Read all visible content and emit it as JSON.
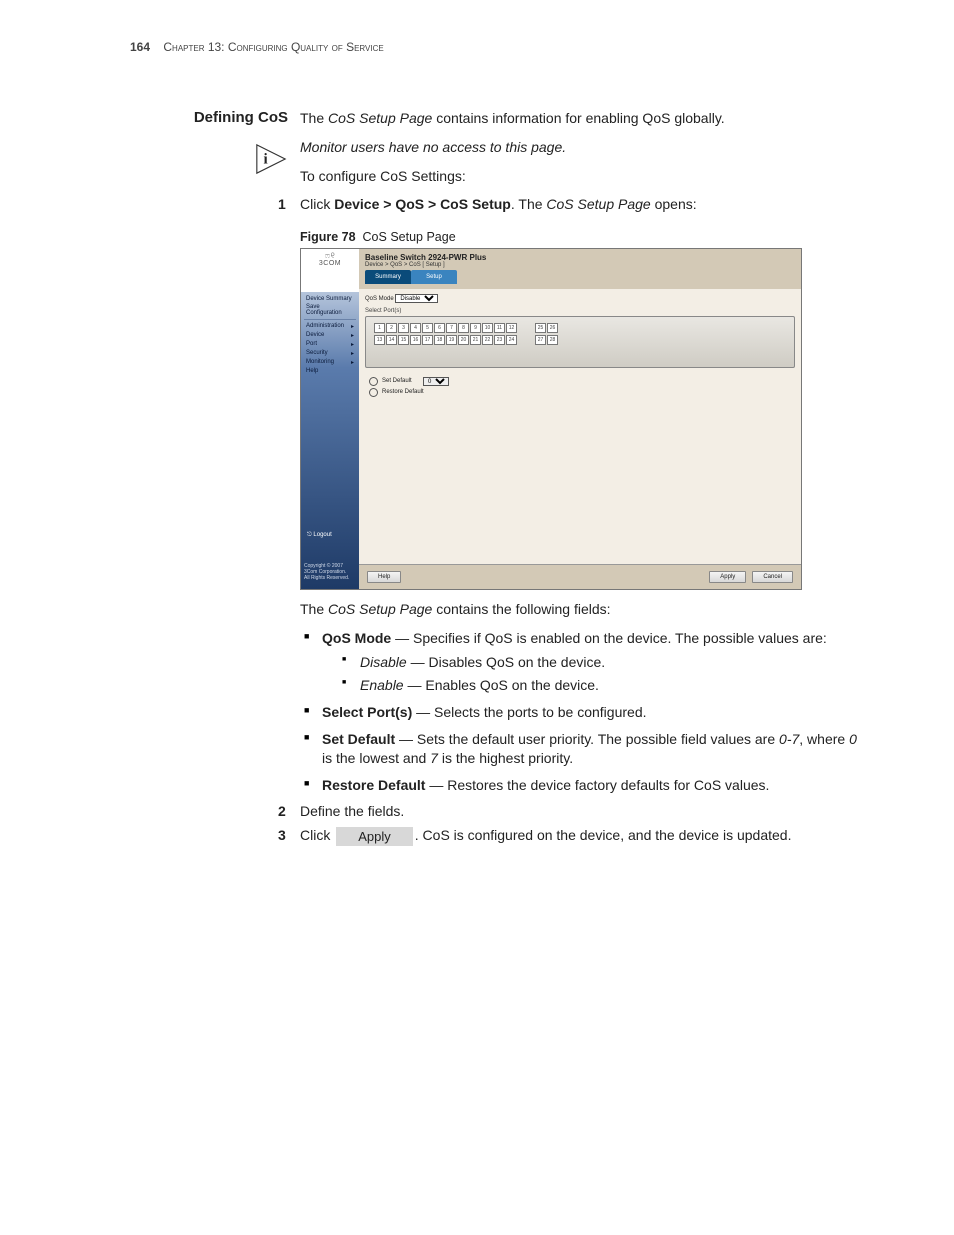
{
  "header": {
    "page_number": "164",
    "chapter": "Chapter 13: Configuring Quality of Service"
  },
  "section": {
    "title": "Defining CoS",
    "intro_pre": "The ",
    "intro_em": "CoS Setup Page",
    "intro_post": " contains information for enabling QoS globally.",
    "note": "Monitor users have no access to this page.",
    "subintro": "To configure CoS Settings:"
  },
  "steps": {
    "s1_num": "1",
    "s1_a": "Click ",
    "s1_b": "Device > QoS > CoS Setup",
    "s1_c": ". The ",
    "s1_d": "CoS Setup Page",
    "s1_e": " opens:",
    "s2_num": "2",
    "s2": "Define the fields.",
    "s3_num": "3",
    "s3_a": "Click ",
    "s3_btn": "Apply",
    "s3_b": ". CoS is configured on the device, and the device is updated."
  },
  "figure": {
    "label": "Figure 78",
    "caption": "CoS Setup Page"
  },
  "shot": {
    "logo": "3COM",
    "title": "Baseline Switch 2924-PWR Plus",
    "breadcrumb": "Device > QoS > CoS [ Setup ]",
    "tab_summary": "Summary",
    "tab_setup": "Setup",
    "qos_label": "QoS Mode",
    "qos_value": "Disable",
    "ports_label": "Select Port(s)",
    "radio_set": "Set Default",
    "set_value": "0",
    "radio_restore": "Restore Default",
    "nav": {
      "dev_summary": "Device Summary",
      "save_conf": "Save Configuration",
      "admin": "Administration",
      "device": "Device",
      "port": "Port",
      "security": "Security",
      "monitoring": "Monitoring",
      "help": "Help"
    },
    "logout": "Logout",
    "copy1": "Copyright © 2007",
    "copy2": "3Com Corporation.",
    "copy3": "All Rights Reserved.",
    "btn_help": "Help",
    "btn_apply": "Apply",
    "btn_cancel": "Cancel",
    "ports_top": [
      "1",
      "2",
      "3",
      "4",
      "5",
      "6",
      "7",
      "8",
      "9",
      "10",
      "11",
      "12"
    ],
    "ports_bot": [
      "13",
      "14",
      "15",
      "16",
      "17",
      "18",
      "19",
      "20",
      "21",
      "22",
      "23",
      "24"
    ],
    "ports_r_top": [
      "25",
      "26"
    ],
    "ports_r_bot": [
      "27",
      "28"
    ]
  },
  "fields_intro_a": "The ",
  "fields_intro_b": "CoS Setup Page",
  "fields_intro_c": " contains the following fields:",
  "fields": {
    "qos_t": "QoS Mode",
    "qos_d": " — Specifies if QoS is enabled on the device. The possible values are:",
    "qos_dis_t": "Disable",
    "qos_dis_d": " — Disables QoS on the device.",
    "qos_en_t": "Enable",
    "qos_en_d": " — Enables QoS on the device.",
    "sel_t": "Select Port(s)",
    "sel_d": " — Selects the ports to be configured.",
    "set_t": "Set Default",
    "set_d1": " — Sets the default user priority. The possible field values are ",
    "set_r": "0-7",
    "set_d2": ", where ",
    "set_z": "0",
    "set_d3": " is the lowest and ",
    "set_s": "7",
    "set_d4": " is the highest priority.",
    "res_t": "Restore Default",
    "res_d": " — Restores the device factory defaults for CoS values."
  }
}
